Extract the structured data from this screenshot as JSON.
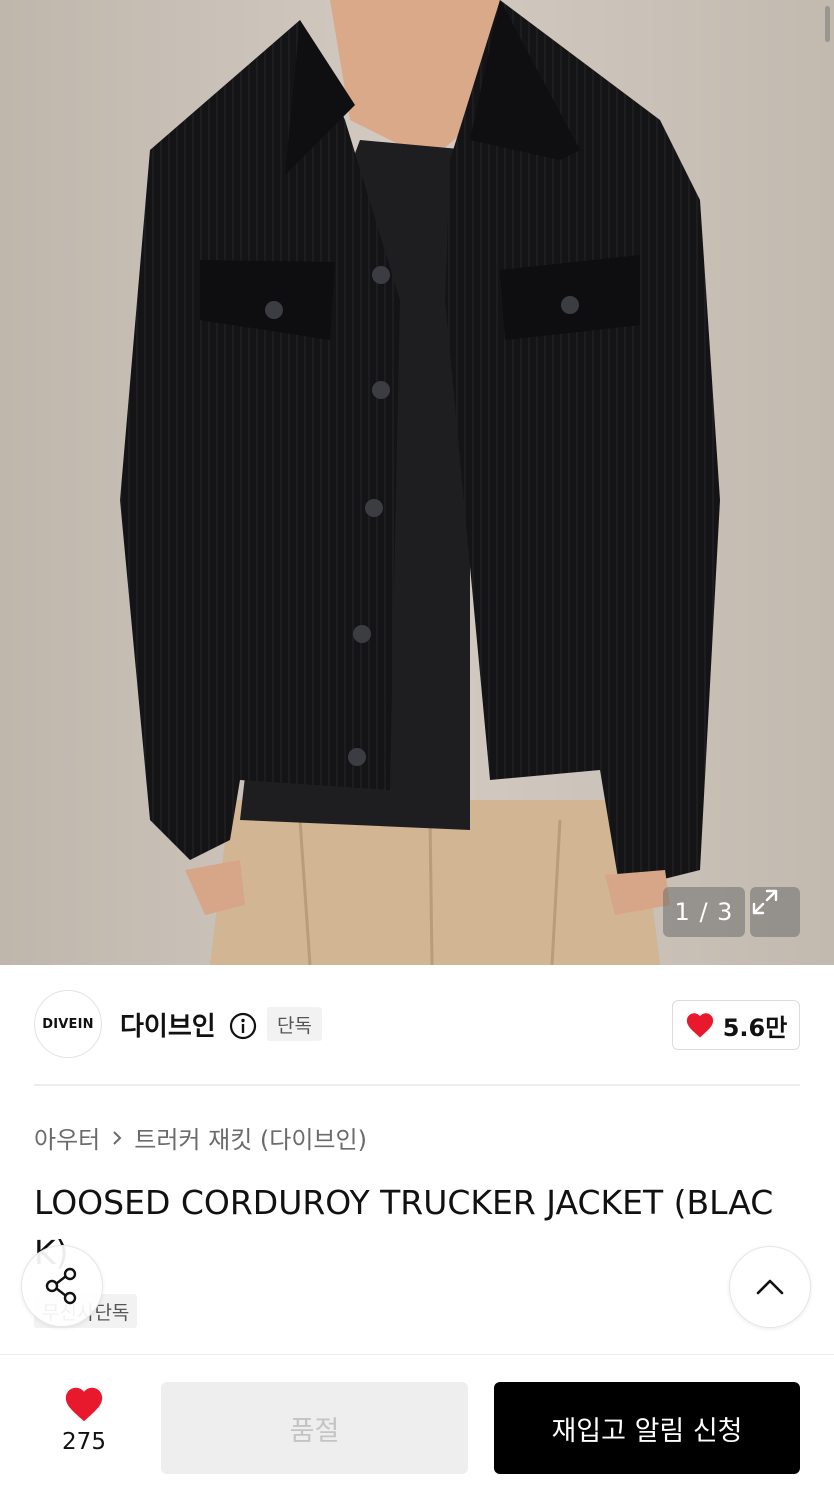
{
  "gallery": {
    "counter": "1 / 3",
    "current_index": 1,
    "total": 3
  },
  "brand": {
    "logo_text": "DIVEIN",
    "name": "다이브인",
    "exclusive_tag": "단독",
    "like_count": "5.6만"
  },
  "breadcrumb": {
    "category": "아우터",
    "subcategory": "트러커 재킷 (다이브인)"
  },
  "product": {
    "title": "LOOSED CORDUROY TRUCKER JACKET (BLACK)",
    "sub_tag": "무신사단독"
  },
  "bottom_bar": {
    "wish_count": "275",
    "soldout_label": "품절",
    "restock_label": "재입고 알림 신청"
  },
  "icons": {
    "heart": "heart-icon",
    "share": "share-icon",
    "top": "chevron-up-icon",
    "expand": "expand-icon",
    "info": "info-icon"
  },
  "colors": {
    "accent_red": "#e8182d",
    "restock_bg": "#000000",
    "soldout_bg": "#eeeeee"
  }
}
